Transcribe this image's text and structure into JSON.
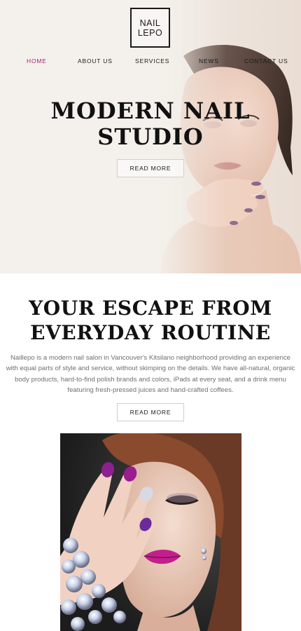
{
  "brand": {
    "line1": "NAIL",
    "line2": "LEPO"
  },
  "nav": {
    "items": [
      {
        "label": "HOME",
        "active": true
      },
      {
        "label": "ABOUT US",
        "active": false
      },
      {
        "label": "SERVICES",
        "active": false
      },
      {
        "label": "NEWS",
        "active": false
      },
      {
        "label": "CONTACT US",
        "active": false
      }
    ]
  },
  "hero": {
    "title_line1": "MODERN NAIL",
    "title_line2": "STUDIO",
    "button_label": "READ MORE"
  },
  "about": {
    "title_line1": "YOUR ESCAPE FROM",
    "title_line2": "EVERYDAY ROUTINE",
    "paragraph": "Naillepo is a modern nail salon in Vancouver's Kitsilano neighborhood providing an experience with equal parts of style and service, without skimping on the details. We have all-natural, organic body products, hard-to-find polish brands and colors, iPads at every seat, and a drink menu featuring fresh-pressed juices and hand-crafted coffees.",
    "button_label": "READ MORE"
  },
  "colors": {
    "accent": "#a8236a",
    "text_dark": "#111111",
    "text_muted": "#6f6f6f",
    "hero_bg": "#f1ece6"
  }
}
